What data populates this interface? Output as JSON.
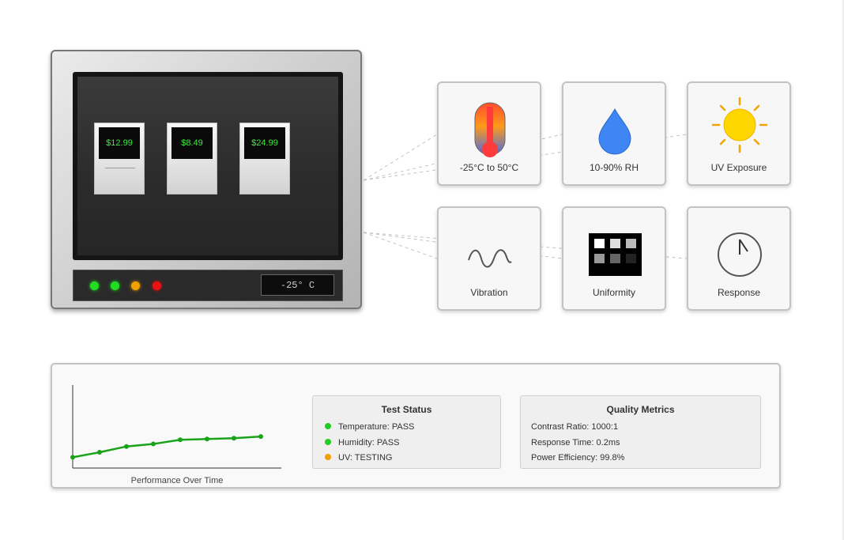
{
  "display": {
    "price_tags": [
      "$12.99",
      "$8.49",
      "$24.99"
    ],
    "indicators": [
      {
        "name": "green",
        "color": "#22dd22"
      },
      {
        "name": "green",
        "color": "#22dd22"
      },
      {
        "name": "orange",
        "color": "#f2a000"
      },
      {
        "name": "red",
        "color": "#ee1111"
      }
    ],
    "temperature_readout": "-25° C"
  },
  "conditions": [
    {
      "label": "-25°C to 50°C",
      "icon": "thermometer-icon"
    },
    {
      "label": "10-90% RH",
      "icon": "water-drop-icon"
    },
    {
      "label": "UV Exposure",
      "icon": "sun-icon"
    },
    {
      "label": "Vibration",
      "icon": "wave-icon"
    },
    {
      "label": "Uniformity",
      "icon": "grid-pattern-icon"
    },
    {
      "label": "Response",
      "icon": "clock-icon"
    }
  ],
  "performance_chart": {
    "caption": "Performance Over Time",
    "line_color": "#1aa31a"
  },
  "chart_data": {
    "type": "line",
    "title": "",
    "xlabel": "Performance Over Time",
    "ylabel": "",
    "x": [
      1,
      2,
      3,
      4,
      5,
      6,
      7,
      8
    ],
    "values": [
      13,
      19,
      26,
      29,
      34,
      35,
      36,
      38
    ],
    "ylim": [
      0,
      100
    ],
    "grid": false
  },
  "test_status": {
    "title": "Test Status",
    "items": [
      {
        "text": "Temperature: PASS",
        "color": "#22cc22"
      },
      {
        "text": "Humidity: PASS",
        "color": "#22cc22"
      },
      {
        "text": "UV: TESTING",
        "color": "#f2a000"
      }
    ]
  },
  "quality_metrics": {
    "title": "Quality Metrics",
    "items": [
      "Contrast Ratio: 1000:1",
      "Response Time: 0.2ms",
      "Power Efficiency: 99.8%"
    ]
  }
}
